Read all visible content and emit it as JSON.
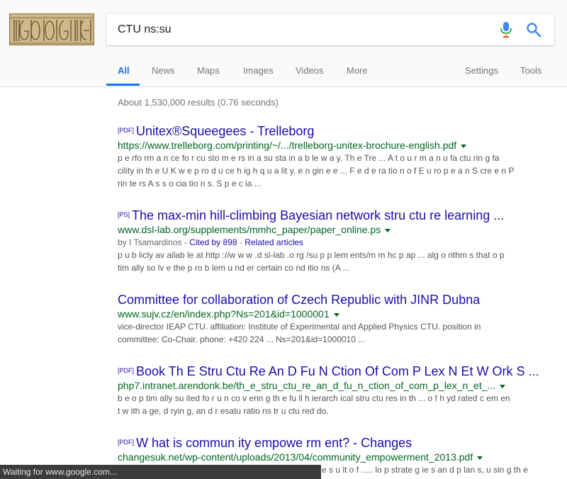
{
  "search": {
    "query": "CTU ns:su"
  },
  "tabs": [
    {
      "label": "All"
    },
    {
      "label": "News"
    },
    {
      "label": "Maps"
    },
    {
      "label": "Images"
    },
    {
      "label": "Videos"
    },
    {
      "label": "More"
    }
  ],
  "tools": {
    "settings": "Settings",
    "tools": "Tools"
  },
  "stats": "About 1,530,000 results (0.76 seconds)",
  "results": [
    {
      "filetype": "[PDF]",
      "title": "Unitex®Squeegees - Trelleborg",
      "url": "https://www.trelleborg.com/printing/~/.../trelleborg-unitex-brochure-english.pdf",
      "snippet_lines": [
        "p e rfo rm a n ce fo r cu sto m e rs in a su sta in a b le w a y. Th e Tre ... A t o u r m a n u fa ctu rin g fa",
        "cility in th e U K w e p ro d u ce h ig h q u a lit y. e n gin e e ... F e d e ra tio n o f E u ro p e a n S cre e n P",
        "rin te rs A s s o cia tio n s. S p e c ia ..."
      ]
    },
    {
      "filetype": "[PS]",
      "title": "The max-min hill-climbing Bayesian network stru ctu re learning ...",
      "url": "www.dsl-lab.org/supplements/mmhc_paper/paper_online.ps",
      "meta_prefix": "by I Tsamardinos - ",
      "cited": "Cited by 898",
      "meta_sep": " - ",
      "related": "Related articles",
      "snippet_lines": [
        "p u b licly av ailab le at http ://w w w .d sl-lab .o rg /su p p lem ents/m m hc p ap ... alg o rithm s that o p",
        "tim ally so lv e the p ro b lem u nd er certain co nd itio ns (A ..."
      ]
    },
    {
      "title": "Committee for collaboration of Czech Republic with JINR Dubna",
      "url": "www.sujv.cz/en/index.php?Ns=201&id=1000001",
      "snippet_lines": [
        "vice-director IEAP CTU. affiliation: Institute of Experimental and Applied Physics CTU. position in",
        "committee: Co-Chair. phone: +420 224 ... Ns=201&id=1000010 ..."
      ]
    },
    {
      "filetype": "[PDF]",
      "title": "Book Th E Stru Ctu Re An D Fu N Ction Of Com P Lex N Et W Ork S ...",
      "url": "php7.intranet.arendonk.be/th_e_stru_ctu_re_an_d_fu_n_ction_of_com_p_lex_n_et_...",
      "snippet_lines": [
        "b e o p tim ally su ited fo r u n co v erin g th e fu ll h ierarch ical stru ctu res in th ... o f h yd rated c em en",
        "t w ith a ge, d ryin g, an d r esatu ratio ns tr u ctu red do."
      ]
    },
    {
      "filetype": "[PDF]",
      "title": "W hat is commun ity empowe rm ent? - Changes",
      "url": "changesuk.net/wp-content/uploads/2013/04/community_empowerment_2013.pdf",
      "snippet_lines": [
        "e s u lt o f ..... lo p strate g ie s an d p lan s, u sin g th e"
      ]
    }
  ],
  "status": "Waiting for www.google.com..."
}
